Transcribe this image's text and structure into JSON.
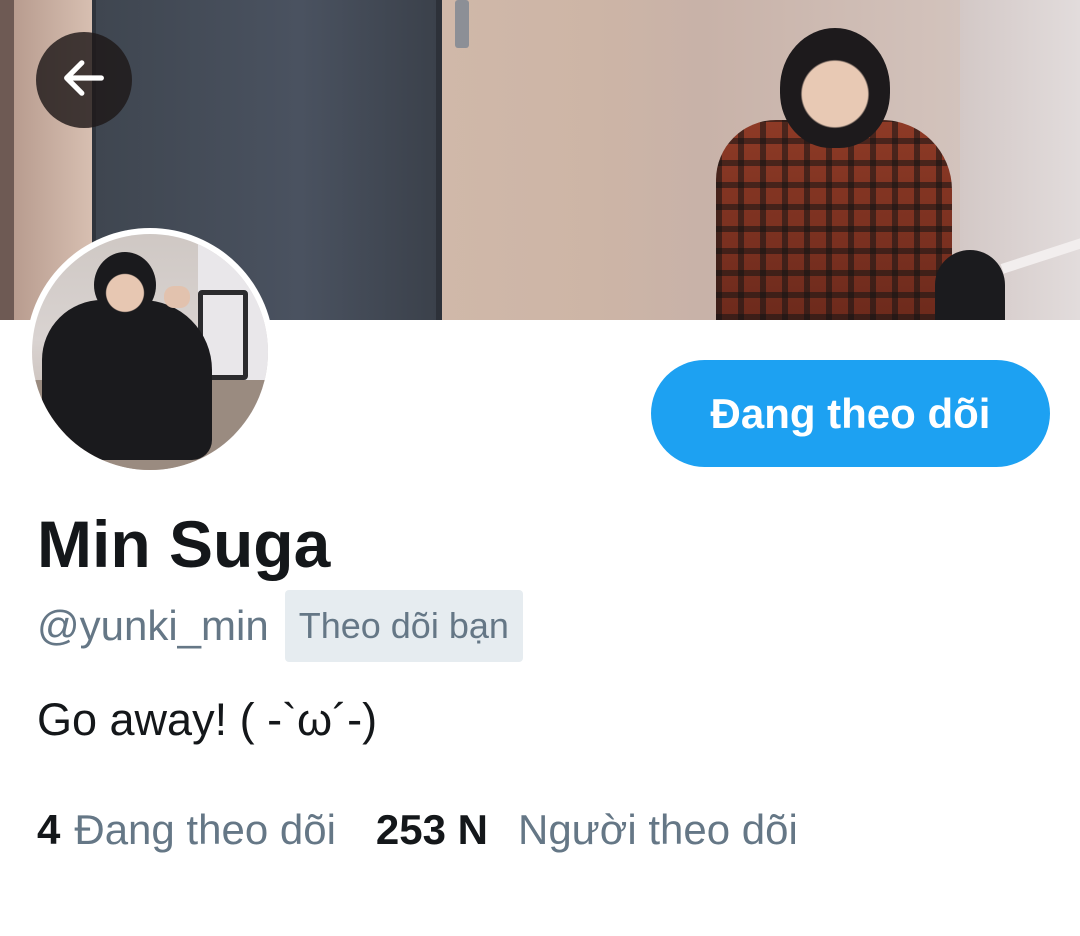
{
  "header": {
    "back_icon": "arrow-left-icon"
  },
  "profile": {
    "display_name": "Min Suga",
    "handle": "@yunki_min",
    "follows_you_badge": "Theo dõi bạn",
    "bio": "Go away! ( -`ω´-)",
    "follow_button_label": "Đang theo dõi",
    "stats": {
      "following_count": "4",
      "following_label": "Đang theo dõi",
      "followers_count": "253 N",
      "followers_label": "Người theo dõi"
    }
  },
  "colors": {
    "accent": "#1da1f2",
    "secondary_text": "#657786",
    "primary_text": "#14171a",
    "badge_bg": "#e6ecf0"
  }
}
